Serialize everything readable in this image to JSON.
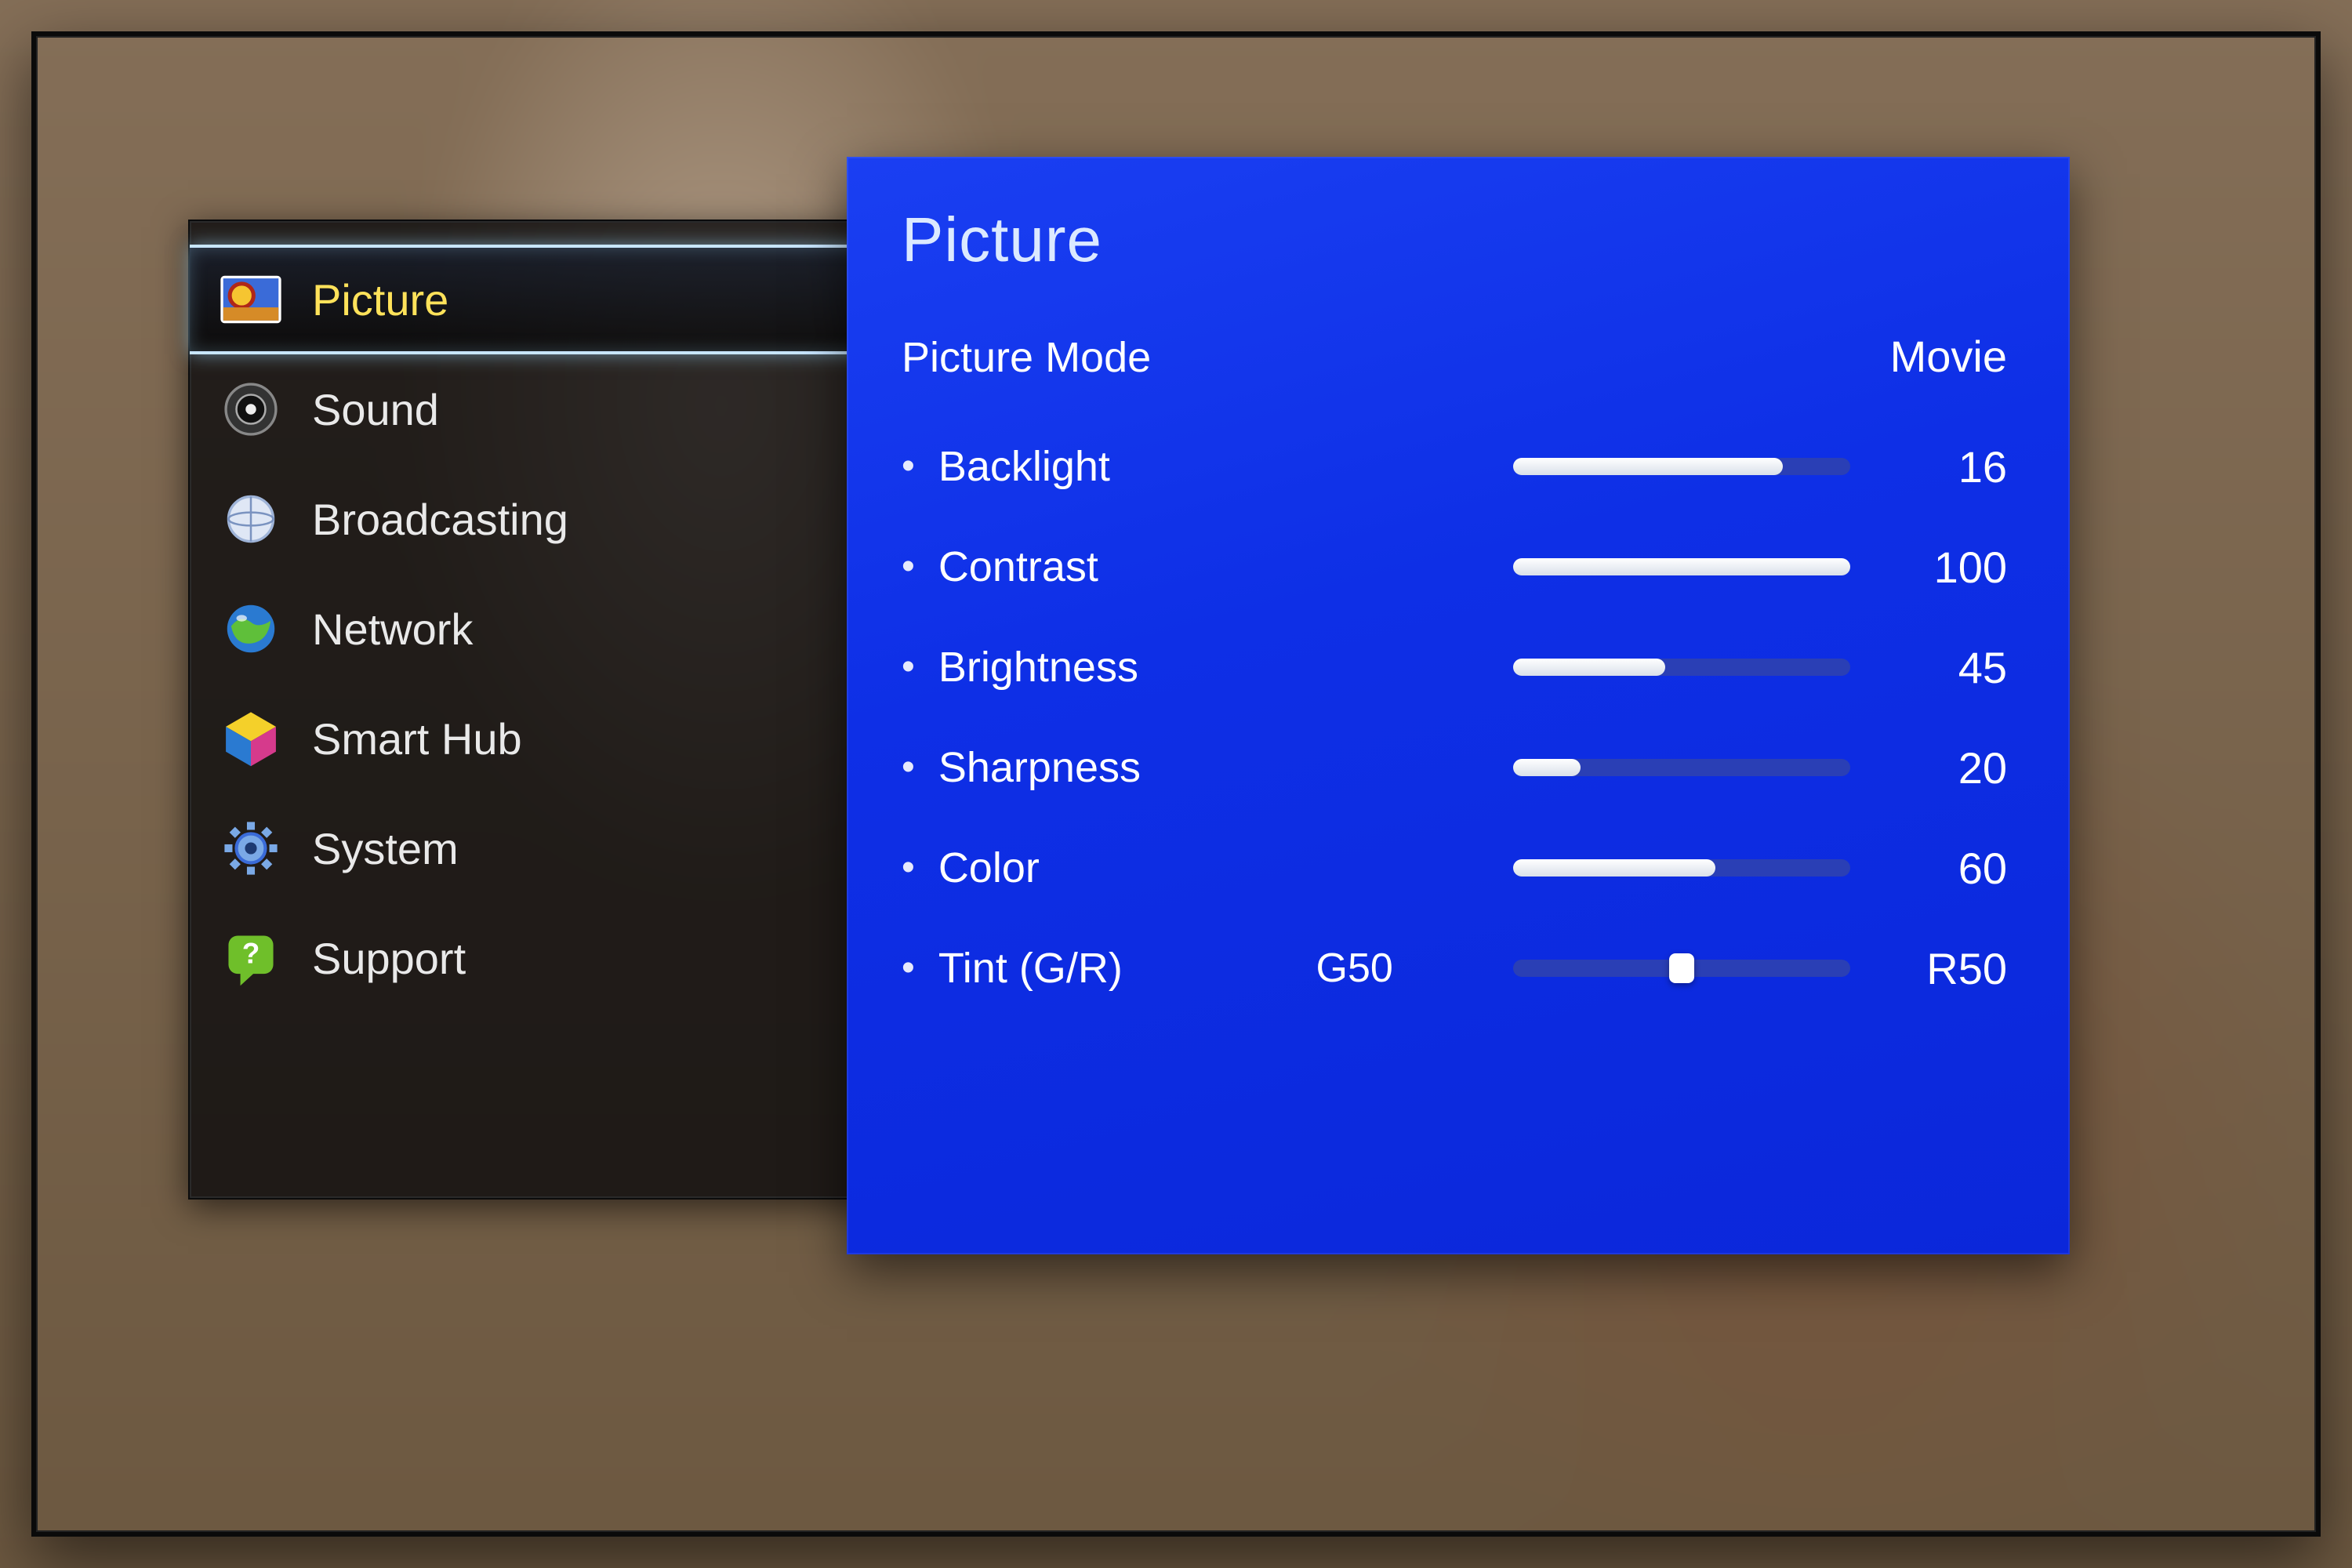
{
  "sidebar": {
    "items": [
      {
        "id": "picture",
        "label": "Picture",
        "icon": "balloon-icon",
        "active": true
      },
      {
        "id": "sound",
        "label": "Sound",
        "icon": "speaker-icon",
        "active": false
      },
      {
        "id": "broadcasting",
        "label": "Broadcasting",
        "icon": "antenna-icon",
        "active": false
      },
      {
        "id": "network",
        "label": "Network",
        "icon": "globe-icon",
        "active": false
      },
      {
        "id": "smart-hub",
        "label": "Smart Hub",
        "icon": "cube-icon",
        "active": false
      },
      {
        "id": "system",
        "label": "System",
        "icon": "gear-icon",
        "active": false
      },
      {
        "id": "support",
        "label": "Support",
        "icon": "question-icon",
        "active": false
      }
    ]
  },
  "panel": {
    "title": "Picture",
    "picture_mode": {
      "label": "Picture Mode",
      "value": "Movie"
    },
    "settings": [
      {
        "id": "backlight",
        "label": "Backlight",
        "value": 16,
        "max": 20,
        "display": "16"
      },
      {
        "id": "contrast",
        "label": "Contrast",
        "value": 100,
        "max": 100,
        "display": "100"
      },
      {
        "id": "brightness",
        "label": "Brightness",
        "value": 45,
        "max": 100,
        "display": "45"
      },
      {
        "id": "sharpness",
        "label": "Sharpness",
        "value": 20,
        "max": 100,
        "display": "20"
      },
      {
        "id": "color",
        "label": "Color",
        "value": 60,
        "max": 100,
        "display": "60"
      },
      {
        "id": "tint",
        "label": "Tint (G/R)",
        "value": 50,
        "max": 100,
        "display": "R50",
        "left_display": "G50",
        "center": true
      }
    ]
  },
  "colors": {
    "panel_blue": "#0e2fe6",
    "highlight_yellow": "#ffe25a",
    "glow_blue": "#c8e6ff"
  }
}
